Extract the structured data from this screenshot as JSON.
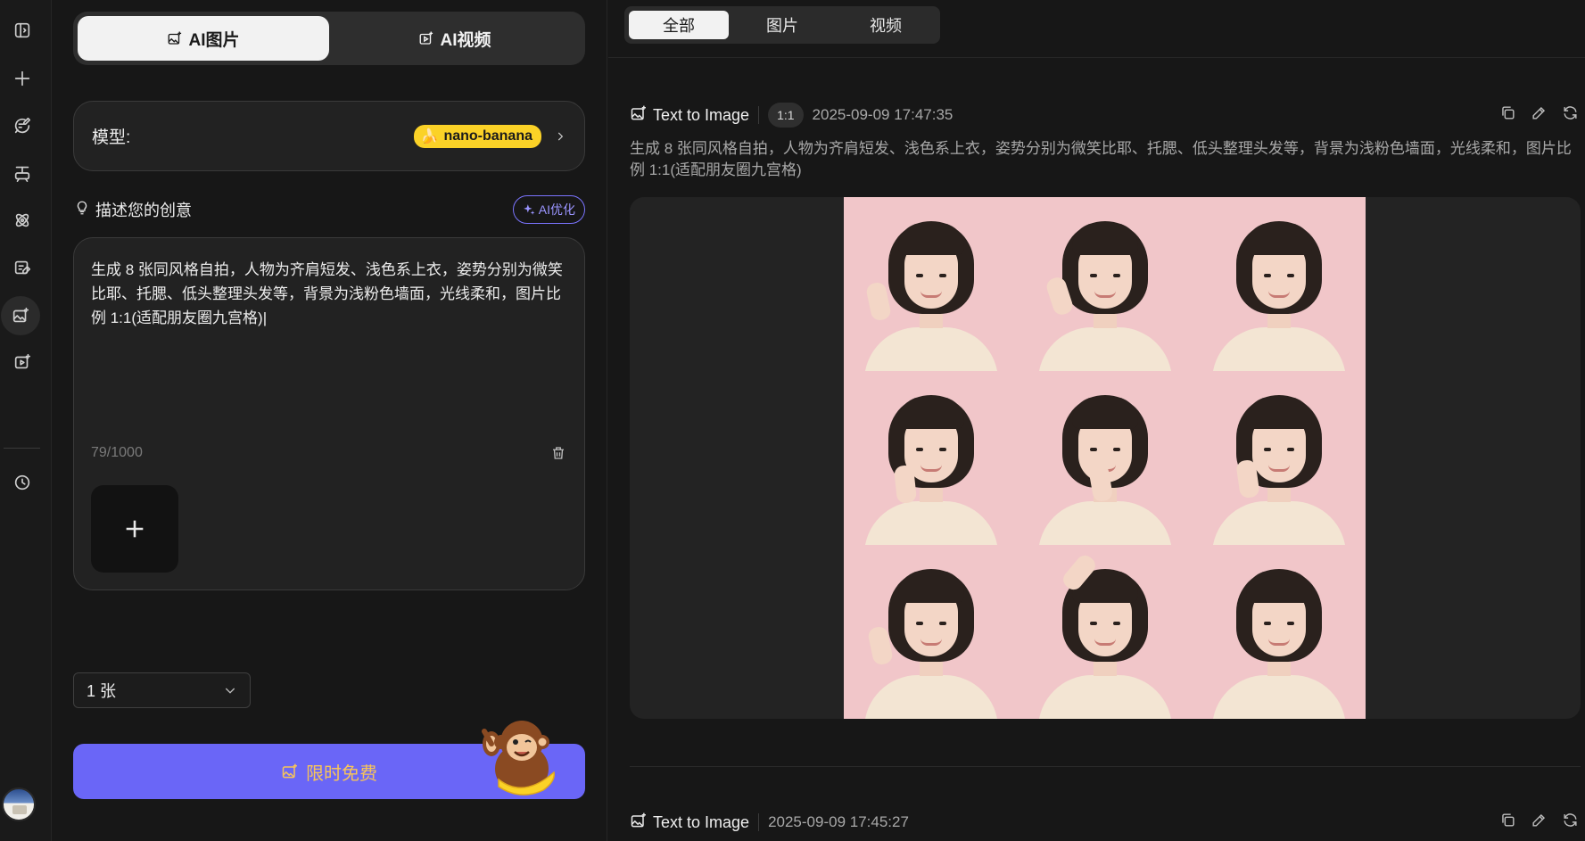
{
  "sidebar": {
    "icons": [
      "sidebar-toggle-icon",
      "plus-icon",
      "chat-edit-icon",
      "text-tool-icon",
      "atom-icon",
      "image-edit-icon",
      "image-sparkle-icon",
      "video-sparkle-icon",
      "history-clock-icon"
    ],
    "active_index": 6
  },
  "mode": {
    "tabs": [
      {
        "label": "AI图片",
        "icon": "image-sparkle-icon",
        "active": true
      },
      {
        "label": "AI视频",
        "icon": "video-sparkle-icon",
        "active": false
      }
    ]
  },
  "model": {
    "label": "模型:",
    "value": "nano-banana",
    "badge_icon": "banana-icon",
    "badge_color": "#fbd227"
  },
  "prompt_section": {
    "title": "描述您的创意",
    "ai_optimize_label": "AI优化",
    "text": "生成 8 张同风格自拍，人物为齐肩短发、浅色系上衣，姿势分别为微笑比耶、托腮、低头整理头发等，背景为浅粉色墙面，光线柔和，图片比例 1:1(适配朋友圈九宫格)",
    "char_count": "79/1000"
  },
  "quantity": {
    "selected": "1 张"
  },
  "generate": {
    "label": "限时免费",
    "bg_color": "#6a66f7",
    "text_color": "#f7c45a"
  },
  "filters": {
    "tabs": [
      {
        "label": "全部",
        "active": true
      },
      {
        "label": "图片",
        "active": false
      },
      {
        "label": "视频",
        "active": false
      }
    ]
  },
  "generations": [
    {
      "type": "Text to Image",
      "ratio": "1:1",
      "time": "2025-09-09 17:47:35",
      "prompt": "生成 8 张同风格自拍，人物为齐肩短发、浅色系上衣，姿势分别为微笑比耶、托腮、低头整理头发等，背景为浅粉色墙面，光线柔和，图片比例 1:1(适配朋友圈九宫格)"
    },
    {
      "type": "Text to Image",
      "time": "2025-09-09 17:45:27"
    }
  ]
}
